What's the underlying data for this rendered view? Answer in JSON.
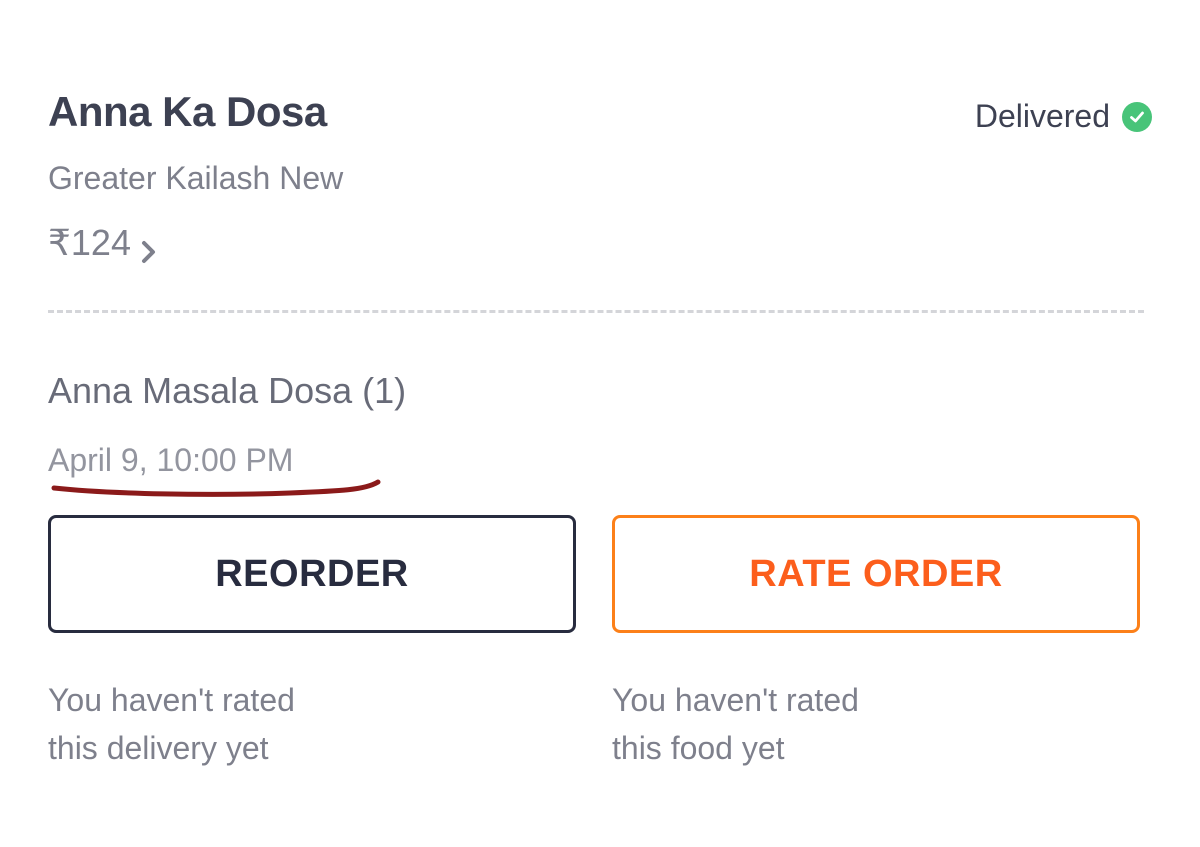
{
  "order": {
    "restaurant_name": "Anna Ka Dosa",
    "location": "Greater Kailash New",
    "price": "₹124",
    "status": "Delivered",
    "item": "Anna Masala Dosa (1)",
    "date_time": "April 9, 10:00 PM"
  },
  "actions": {
    "reorder_label": "REORDER",
    "rate_label": "RATE ORDER"
  },
  "notes": {
    "delivery_line1": "You haven't rated",
    "delivery_line2": "this delivery yet",
    "food_line1": "You haven't rated",
    "food_line2": "this food yet"
  },
  "icons": {
    "status": "check-circle-icon",
    "price": "chevron-right-icon"
  },
  "colors": {
    "primary_text": "#3d4152",
    "secondary_text": "#7e808c",
    "success": "#48c479",
    "accent": "#fc8019",
    "dark_button": "#282c3f",
    "annotation": "#8b1a1a"
  }
}
